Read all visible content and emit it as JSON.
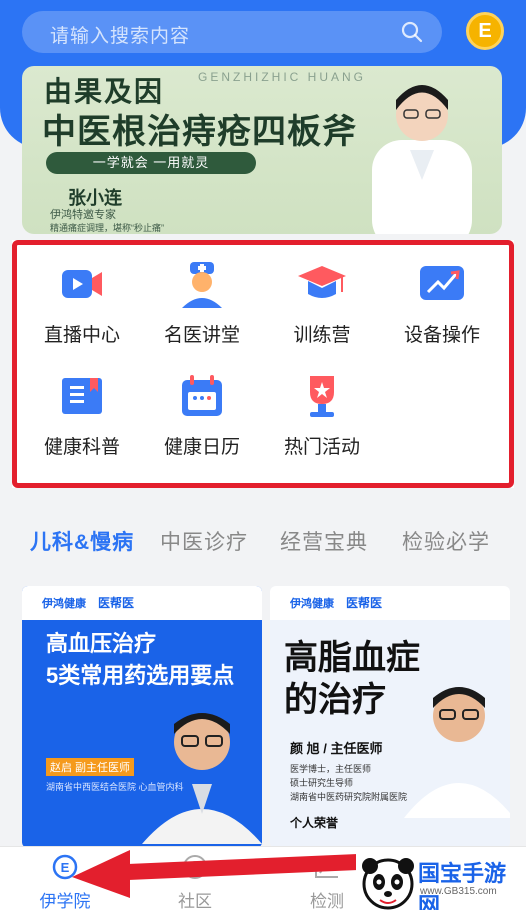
{
  "colors": {
    "primary": "#2c74f4",
    "highlight_frame": "#e31f2d",
    "coin": "#f6b300"
  },
  "search": {
    "placeholder": "请输入搜索内容",
    "icon": "search-icon"
  },
  "header": {
    "coin_icon": "coin-icon",
    "coin_letter": "E"
  },
  "banner": {
    "title_line1": "由果及因",
    "title_line2": "中医根治痔疮四板斧",
    "pinyin": "GENZHIZHIC HUANG",
    "pill_text": "一学就会 一用就灵",
    "speaker_name": "张小连",
    "speaker_role": "伊鸿特邀专家",
    "speaker_note": "精通痛症调理，堪称“秒止痛”"
  },
  "services": [
    {
      "label": "直播中心",
      "icon": "live-video-icon"
    },
    {
      "label": "名医讲堂",
      "icon": "doctor-icon"
    },
    {
      "label": "训练营",
      "icon": "graduation-cap-icon"
    },
    {
      "label": "设备操作",
      "icon": "trend-chart-icon"
    },
    {
      "label": "健康科普",
      "icon": "book-icon"
    },
    {
      "label": "健康日历",
      "icon": "calendar-icon"
    },
    {
      "label": "热门活动",
      "icon": "trophy-icon"
    }
  ],
  "tabs": [
    {
      "label": "儿科&慢病",
      "active": true
    },
    {
      "label": "中医诊疗",
      "active": false
    },
    {
      "label": "经营宝典",
      "active": false
    },
    {
      "label": "检验必学",
      "active": false
    }
  ],
  "cards": {
    "left": {
      "brand": "伊鸿健康",
      "brand2": "医帮医",
      "title_line1": "高血压治疗",
      "title_line2": "5类常用药选用要点",
      "doctor_name": "赵启 副主任医师",
      "hospital": "湖南省中西医结合医院 心血管内科"
    },
    "right": {
      "brand": "伊鸿健康",
      "brand2": "医帮医",
      "title_line1": "高脂血症",
      "title_line2": "的治疗",
      "doctor_name": "颜 旭 / 主任医师",
      "line1": "医学博士，主任医师",
      "line2": "硕士研究生导师",
      "line3": "湖南省中医药研究院附属医院",
      "honor": "个人荣誉"
    }
  },
  "bottom_nav": [
    {
      "label": "伊学院",
      "icon": "academy-e-icon",
      "active": true
    },
    {
      "label": "社区",
      "icon": "community-icon",
      "active": false
    },
    {
      "label": "检测",
      "icon": "chart-icon",
      "active": false
    }
  ],
  "watermark": {
    "name": "国宝手游网",
    "url": "www.GB315.com"
  }
}
